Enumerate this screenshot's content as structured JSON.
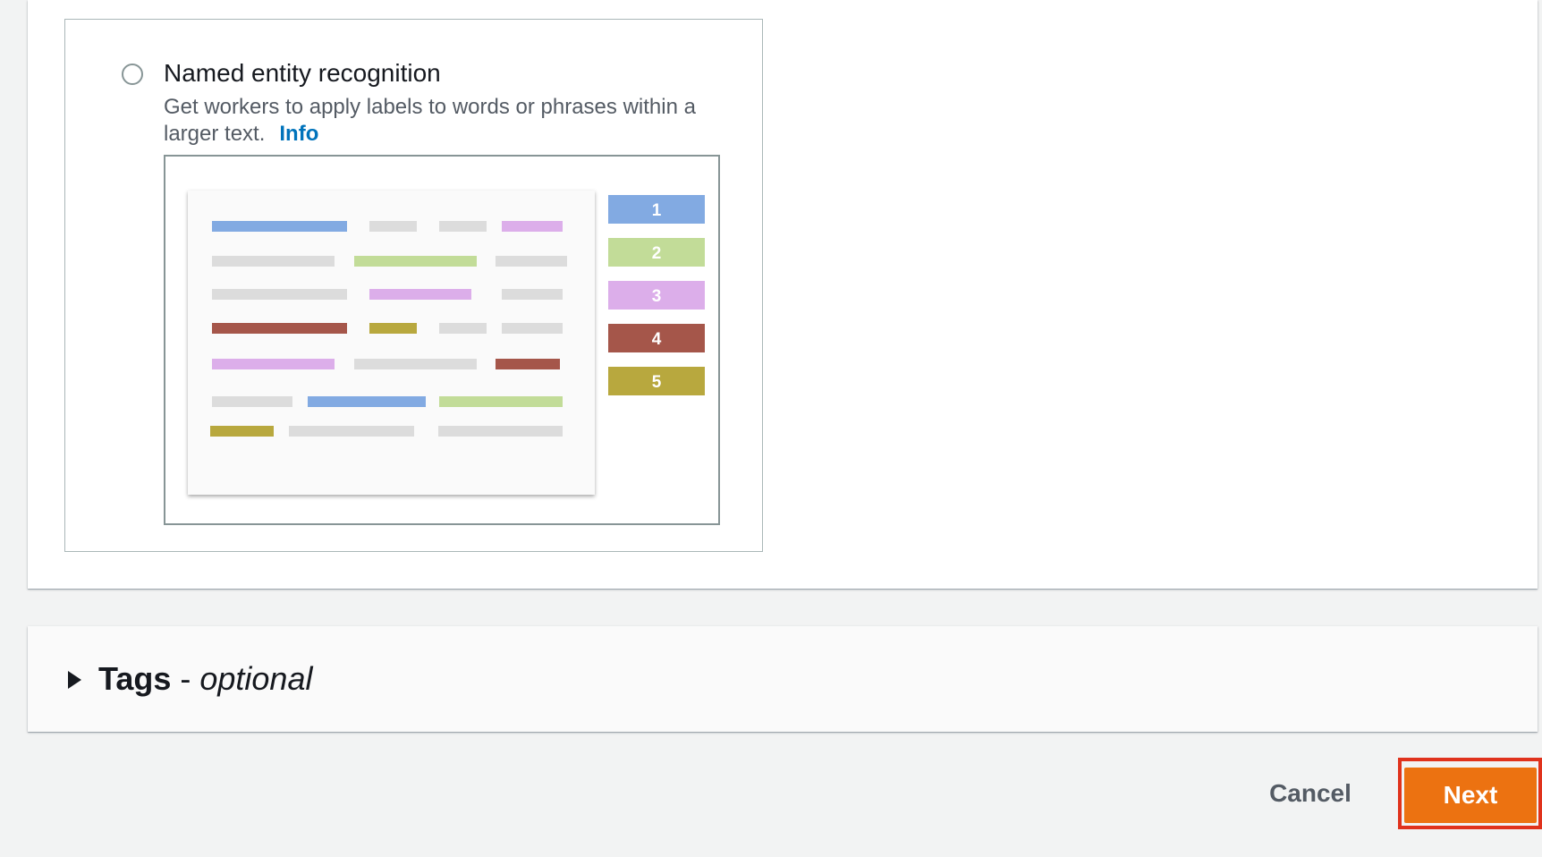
{
  "option": {
    "title": "Named entity recognition",
    "description": "Get workers to apply labels to words or phrases within a larger text.",
    "info_link": "Info",
    "selected": false
  },
  "preview": {
    "labels": [
      {
        "number": "1",
        "color": "#82aae2"
      },
      {
        "number": "2",
        "color": "#c2dc98"
      },
      {
        "number": "3",
        "color": "#dcaeea"
      },
      {
        "number": "4",
        "color": "#a5564a"
      },
      {
        "number": "5",
        "color": "#b8a83e"
      }
    ],
    "neutral_color": "#dcdcdc"
  },
  "tags": {
    "title": "Tags",
    "separator": " - ",
    "optional": "optional",
    "expanded": false
  },
  "footer": {
    "cancel_label": "Cancel",
    "next_label": "Next"
  },
  "colors": {
    "primary_button": "#ec7211",
    "link": "#0073bb",
    "highlight": "#e0321c"
  }
}
